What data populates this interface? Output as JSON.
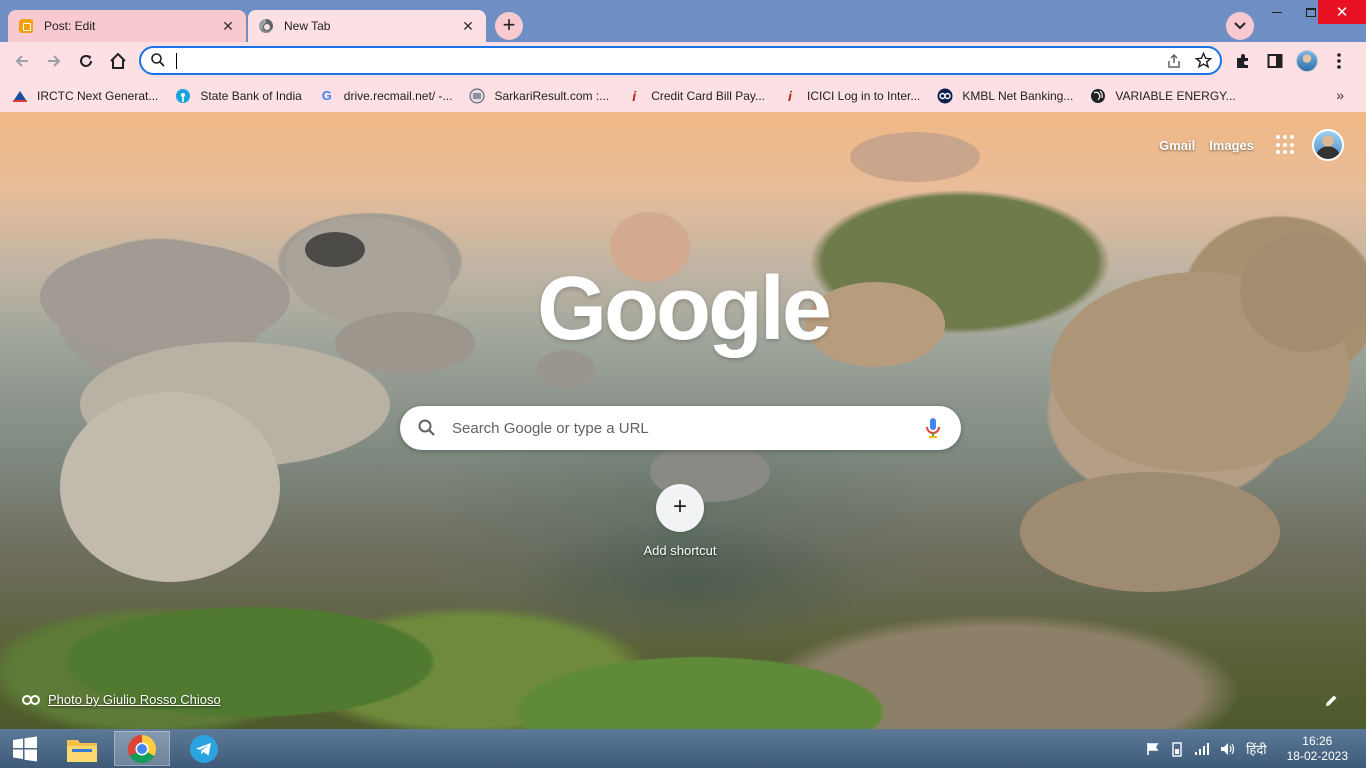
{
  "tabs": [
    {
      "title": "Post: Edit",
      "icon": "blogger-icon"
    },
    {
      "title": "New Tab",
      "icon": "chrome-icon"
    }
  ],
  "window_controls": {
    "minimize": "—",
    "maximize": "□",
    "close": "✕"
  },
  "omnibox": {
    "value": "",
    "placeholder": ""
  },
  "bookmarks": [
    {
      "label": "IRCTC Next Generat...",
      "icon": "irctc-icon"
    },
    {
      "label": "State Bank of India",
      "icon": "sbi-icon"
    },
    {
      "label": "drive.recmail.net/ -...",
      "icon": "google-icon"
    },
    {
      "label": "SarkariResult.com :...",
      "icon": "sarkari-icon"
    },
    {
      "label": "Credit Card Bill Pay...",
      "icon": "icici-icon"
    },
    {
      "label": "ICICI Log in to Inter...",
      "icon": "icici-icon"
    },
    {
      "label": "KMBL Net Banking...",
      "icon": "kotak-icon"
    },
    {
      "label": "VARIABLE ENERGY...",
      "icon": "globe-icon"
    }
  ],
  "ntp": {
    "gmail": "Gmail",
    "images": "Images",
    "logo": "Google",
    "search_placeholder": "Search Google or type a URL",
    "add_shortcut": "Add shortcut",
    "attribution": "Photo by Giulio Rosso Chioso"
  },
  "taskbar": {
    "language": "हिंदी",
    "time": "16:26",
    "date": "18-02-2023"
  },
  "colors": {
    "frame": "#6f8fc4",
    "toolbar": "#fde0e4",
    "active_tab": "#fde0e4",
    "inactive_tab": "#f9c9d0",
    "focus_ring": "#1a73e8",
    "close_red": "#e81123"
  }
}
